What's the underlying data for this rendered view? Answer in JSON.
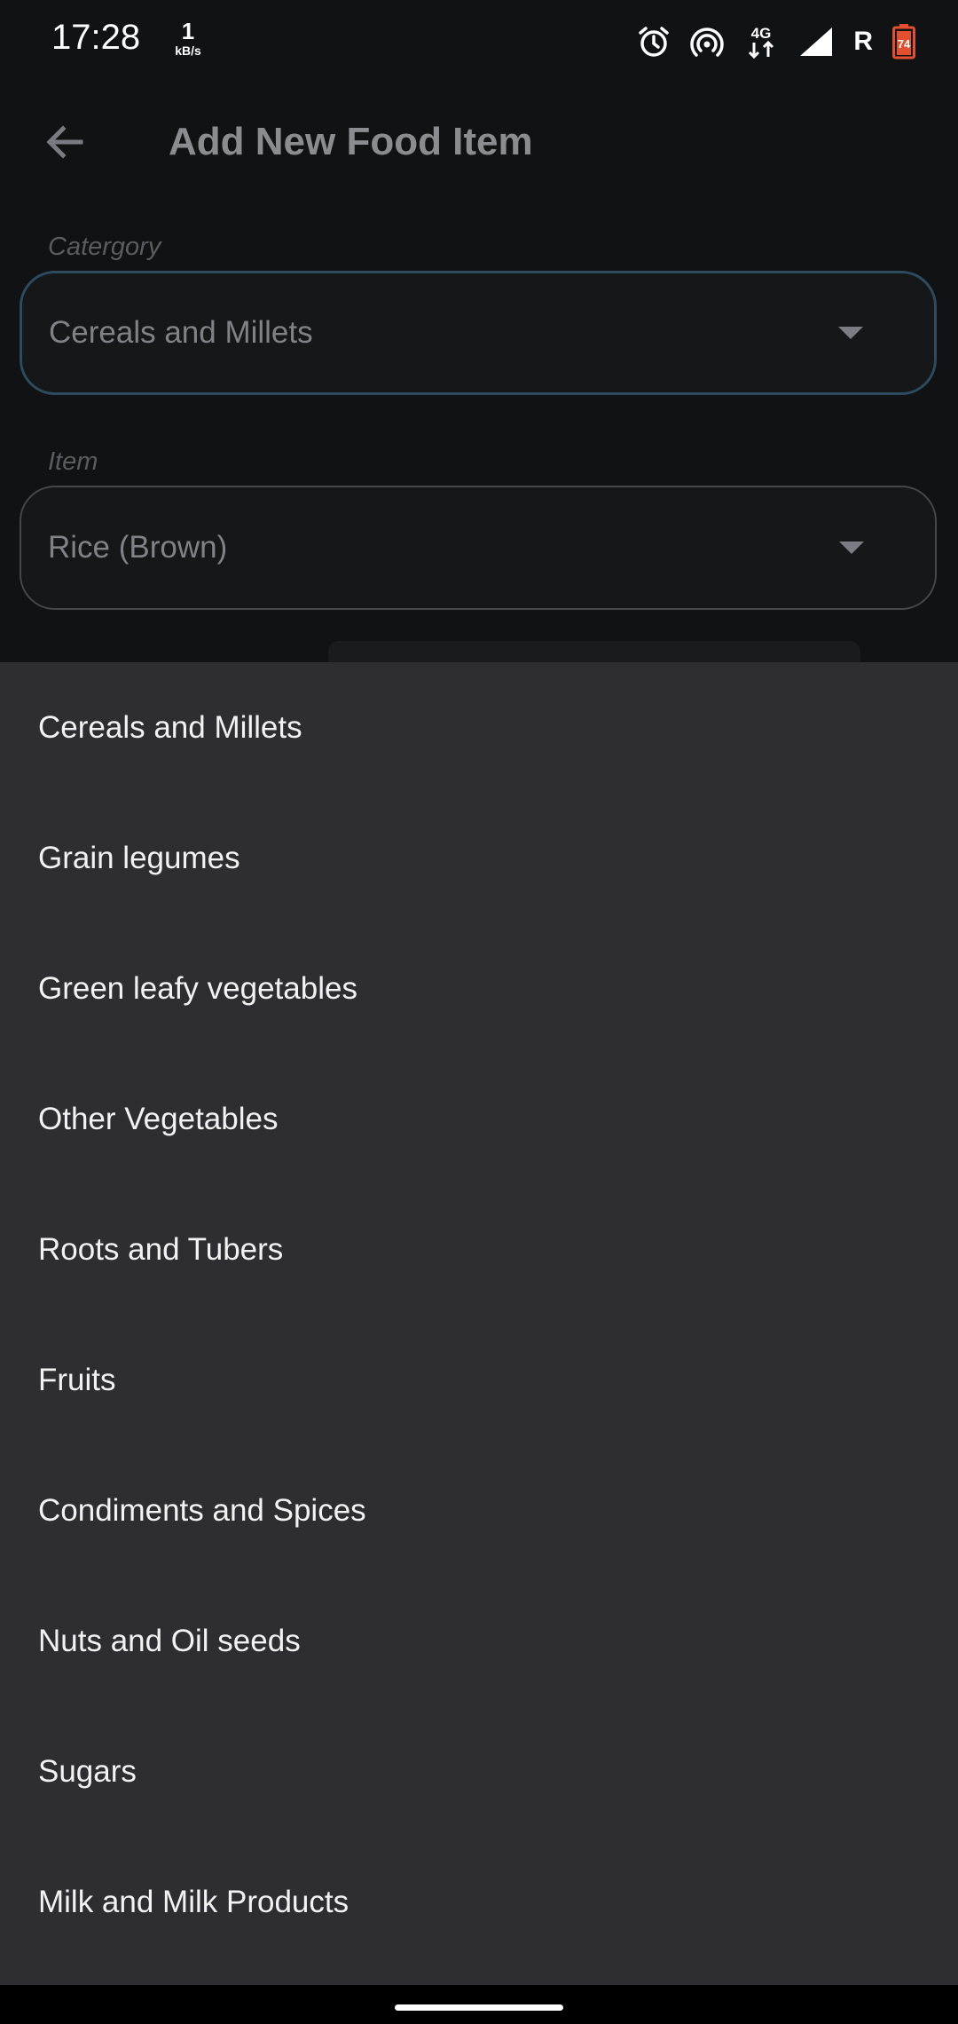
{
  "status_bar": {
    "time": "17:28",
    "net_speed_value": "1",
    "net_speed_unit": "kB/s",
    "network_type": "4G",
    "roaming": "R",
    "battery_level": "74"
  },
  "app_bar": {
    "title": "Add New Food Item",
    "back_icon": "arrow-left-icon"
  },
  "form": {
    "category_label": "Catergory",
    "category_value": "Cereals and Millets",
    "item_label": "Item",
    "item_value": "Rice (Brown)"
  },
  "menu": {
    "items": [
      {
        "label": "Cereals and Millets"
      },
      {
        "label": "Grain legumes"
      },
      {
        "label": "Green leafy vegetables"
      },
      {
        "label": "Other Vegetables"
      },
      {
        "label": "Roots and Tubers"
      },
      {
        "label": "Fruits"
      },
      {
        "label": "Condiments and Spices"
      },
      {
        "label": "Nuts and Oil seeds"
      },
      {
        "label": "Sugars"
      },
      {
        "label": "Milk and Milk Products"
      }
    ]
  },
  "colors": {
    "background": "#111214",
    "menu_background": "#2e2e30",
    "focused_border": "#2c4b5e",
    "battery": "#e2502f"
  }
}
